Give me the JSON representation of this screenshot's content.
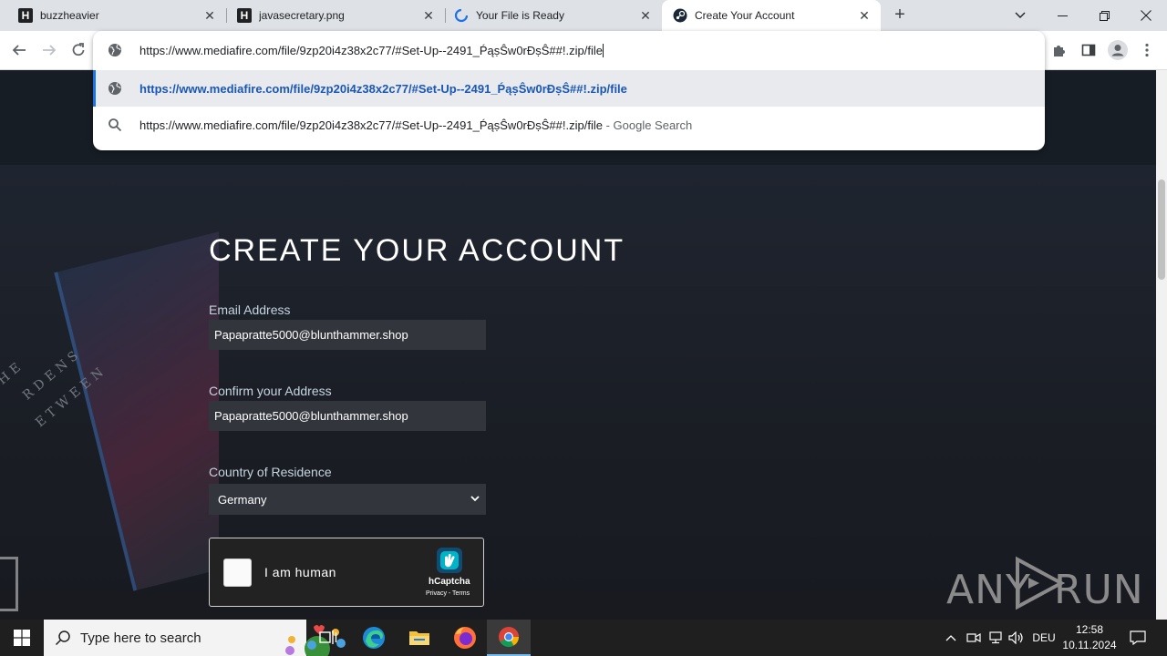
{
  "tabs": [
    {
      "title": "buzzheavier",
      "icon": "h-favicon-icon"
    },
    {
      "title": "javasecretary.png",
      "icon": "h-favicon-icon"
    },
    {
      "title": "Your File is Ready",
      "icon": "loading-spinner-icon"
    },
    {
      "title": "Create Your Account",
      "icon": "steam-icon",
      "active": true
    }
  ],
  "omnibox": {
    "input": "https://www.mediafire.com/file/9zp20i4z38x2c77/#Set-Up--2491_ṔąṣŜw0rĐṣŜ##!.zip/file",
    "suggestions": [
      {
        "text": "https://www.mediafire.com/file/9zp20i4z38x2c77/#Set-Up--2491_ṔąṣŜw0rĐṣŜ##!.zip/file",
        "suffix": "",
        "icon": "globe-icon"
      },
      {
        "text": "https://www.mediafire.com/file/9zp20i4z38x2c77/#Set-Up--2491_ṔąṣŜw0rĐṣŜ##!.zip/file",
        "suffix": " - Google Search",
        "icon": "search-icon"
      }
    ]
  },
  "form": {
    "heading": "CREATE YOUR ACCOUNT",
    "email_label": "Email Address",
    "email_value": "Papapratte5000@blunthammer.shop",
    "confirm_label": "Confirm your Address",
    "confirm_value": "Papapratte5000@blunthammer.shop",
    "country_label": "Country of Residence",
    "country_value": "Germany",
    "captcha_label": "I am human",
    "captcha_brand": "hCaptcha",
    "captcha_links": "Privacy - Terms"
  },
  "art": {
    "line1": "HE",
    "line2": "RDENS",
    "line3": "ETWEEN"
  },
  "watermark": {
    "left": "ANY",
    "right": "RUN"
  },
  "taskbar": {
    "search_placeholder": "Type here to search",
    "language": "DEU",
    "time": "12:58",
    "date": "10.11.2024"
  },
  "colors": {
    "accent": "#1a73e8",
    "page_bg": "#181a21",
    "field_bg": "#32353c",
    "label": "#c6d4df"
  }
}
